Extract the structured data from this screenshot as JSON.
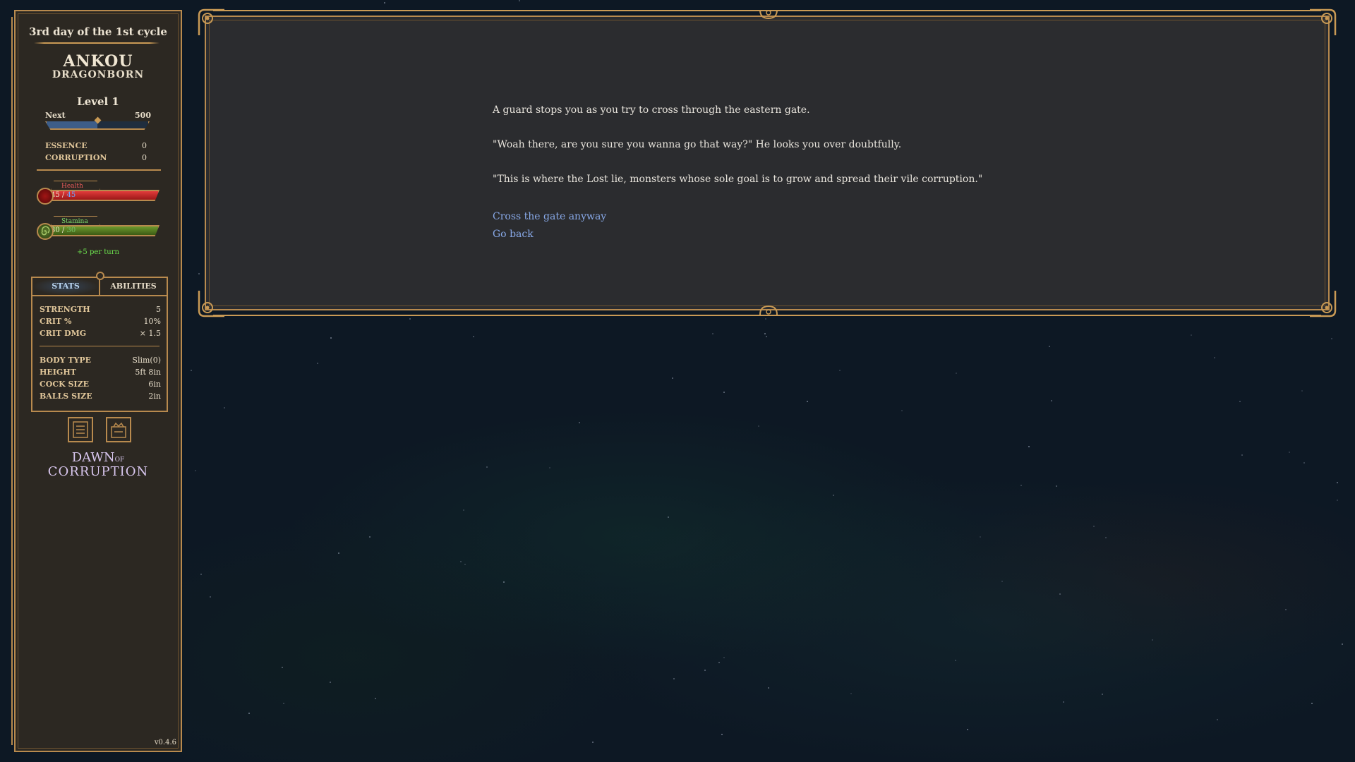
{
  "header": {
    "day": "3rd day of the 1st cycle"
  },
  "character": {
    "name": "ANKOU",
    "race": "DRAGONBORN",
    "level_label": "Level 1",
    "xp": {
      "next_label": "Next",
      "next_value": "500",
      "progress": 0.5
    }
  },
  "resources": [
    {
      "label": "ESSENCE",
      "value": "0"
    },
    {
      "label": "CORRUPTION",
      "value": "0"
    }
  ],
  "health": {
    "label": "Health",
    "current": "45",
    "sep": " / ",
    "max": "45",
    "progress": 1.0
  },
  "stamina": {
    "label": "Stamina",
    "current": "30",
    "sep": " / ",
    "max": "30",
    "progress": 1.0,
    "regen": "+5 per turn"
  },
  "tabs": {
    "stats": "STATS",
    "abilities": "ABILITIES",
    "active": "stats"
  },
  "stats": [
    {
      "label": "STRENGTH",
      "value": "5"
    },
    {
      "label": "CRIT %",
      "value": "10%"
    },
    {
      "label": "CRIT DMG",
      "value": "× 1.5"
    }
  ],
  "body": [
    {
      "label": "BODY TYPE",
      "value": "Slim(0)"
    },
    {
      "label": "HEIGHT",
      "value": "5ft 8in"
    },
    {
      "label": "COCK SIZE",
      "value": "6in"
    },
    {
      "label": "BALLS SIZE",
      "value": "2in"
    }
  ],
  "icons": {
    "journal": "journal-icon",
    "inventory": "inventory-icon"
  },
  "logo": {
    "line1a": "DAWN",
    "line1b": "OF",
    "line2": "CORRUPTION"
  },
  "version": "v0.4.6",
  "story": {
    "paragraphs": [
      "A guard stops you as you try to cross through the eastern gate.",
      "\"Woah there, are you sure you wanna go that way?\" He looks you over doubtfully.",
      "\"This is where the Lost lie, monsters whose sole goal is to grow and spread their vile corruption.\""
    ],
    "choices": [
      "Cross the gate anyway",
      "Go back"
    ]
  },
  "colors": {
    "gold": "#b88a4e",
    "panel": "#2c2822",
    "dialog": "#2b2c2f",
    "link": "#88a9e8",
    "health": "#e23b3b",
    "stamina": "#6d9a2e"
  }
}
